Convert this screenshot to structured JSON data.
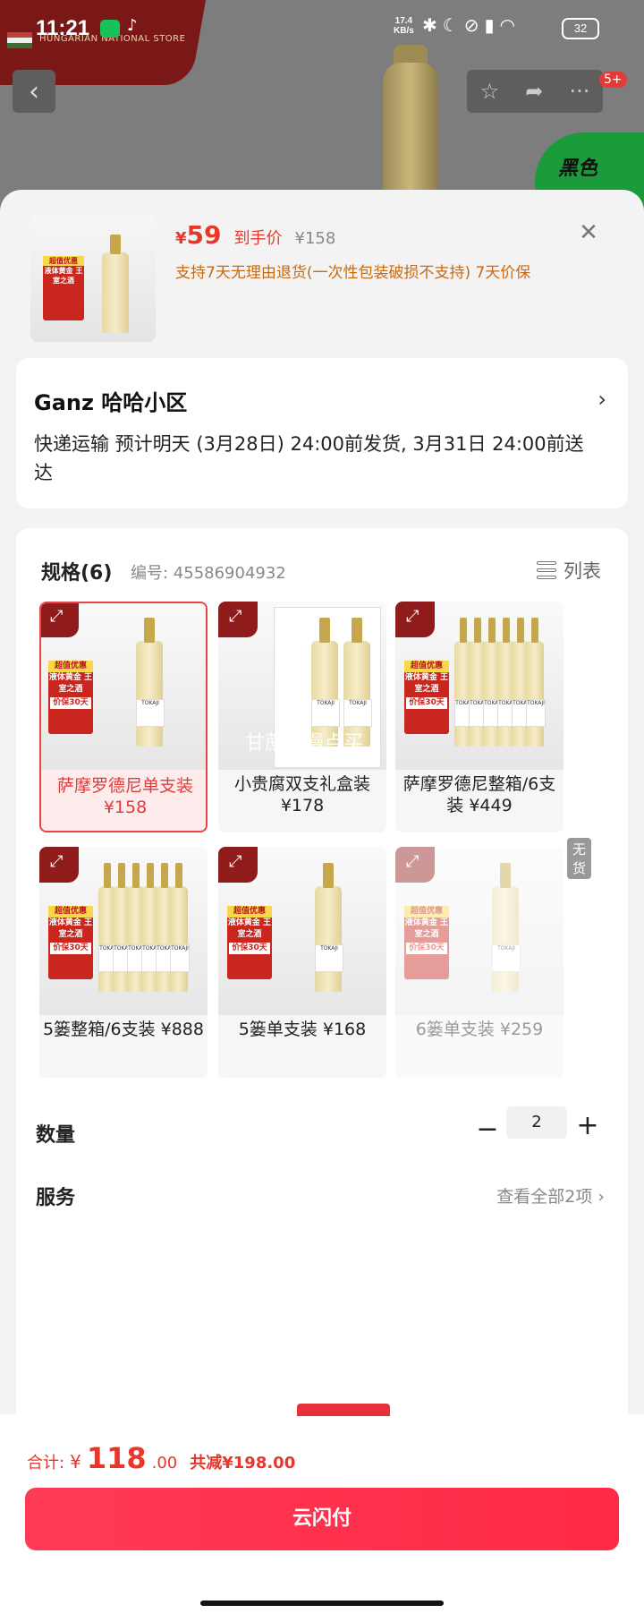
{
  "status_bar": {
    "time": "11:21",
    "net_speed": "17.4",
    "net_unit": "KB/s",
    "battery": "32"
  },
  "background": {
    "store_name": "HUNGARIAN NATIONAL STORE",
    "badge_count": "5+",
    "promo_text": "黑色"
  },
  "product": {
    "price_symbol": "¥",
    "price_value": "59",
    "price_tag": "到手价",
    "original_price": "¥158",
    "policy": "支持7天无理由退货(一次性包装破损不支持)  7天价保",
    "close_icon": "close-icon"
  },
  "address": {
    "name": "Ganz  哈哈小区",
    "shipping": "快递运输 预计明天 (3月28日) 24:00前发货, 3月31日 24:00前送达"
  },
  "spec": {
    "title": "规格(6)",
    "code": "编号: 45586904932",
    "list_label": "列表",
    "watermark": "甘蔗要慢点买",
    "options": [
      {
        "label": "萨摩罗德尼单支装 ¥158",
        "selected": true,
        "available": true,
        "bottles": 1
      },
      {
        "label": "小贵腐双支礼盒装 ¥178",
        "selected": false,
        "available": true,
        "bottles": 2
      },
      {
        "label": "萨摩罗德尼整箱/6支装 ¥449",
        "selected": false,
        "available": true,
        "bottles": 6
      },
      {
        "label": "5篓整箱/6支装 ¥888",
        "selected": false,
        "available": true,
        "bottles": 6
      },
      {
        "label": "5篓单支装 ¥168",
        "selected": false,
        "available": true,
        "bottles": 1
      },
      {
        "label": "6篓单支装 ¥259",
        "selected": false,
        "available": false,
        "bottles": 1
      }
    ],
    "out_of_stock": "无货",
    "tag_top": "超值优惠",
    "tag_main": "液体黄金 王室之酒",
    "tag_sub": "价保30天",
    "bottle_text": "TOKAJI"
  },
  "quantity": {
    "label": "数量",
    "value": "2"
  },
  "service": {
    "label": "服务",
    "link": "查看全部2项"
  },
  "footer": {
    "total_label": "合计:",
    "currency": "¥",
    "total_int": "118",
    "total_dec": ".00",
    "saving": "共减¥198.00",
    "pay_button": "云闪付"
  },
  "colors": {
    "accent": "#e8372a",
    "pay": "#ff2f4b",
    "policy": "#c86a10"
  }
}
